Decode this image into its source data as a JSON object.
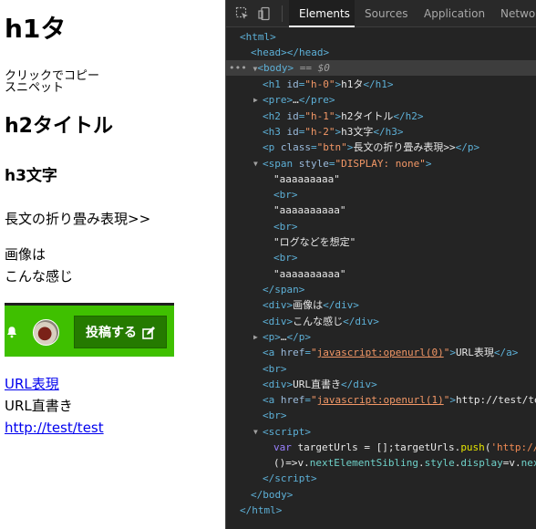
{
  "page": {
    "h1": "h1タ",
    "pre_lines": [
      "クリックでコピー",
      "スニペット"
    ],
    "h2": "h2タイトル",
    "h3": "h3文字",
    "toggle_text": "長文の折り畳み表現>>",
    "image_lines": [
      "画像は",
      "こんな感じ"
    ],
    "post_button_label": "投稿する",
    "link_url_label": "URL表現",
    "url_plain": "URL直書き",
    "url_link": "http://test/test",
    "colors": {
      "post_bar": "#3fc000",
      "post_button": "#257a00",
      "link": "#0000ee"
    }
  },
  "devtools": {
    "toolbar_icons": [
      "inspect-icon",
      "device-toolbar-icon"
    ],
    "tabs": [
      "Elements",
      "Sources",
      "Application",
      "Network"
    ],
    "active_tab": "Elements",
    "tree": {
      "html_open": "html",
      "head": "head",
      "body": "body",
      "selected_marker": "== $0",
      "h1": {
        "id": "h-0",
        "text": "h1タ"
      },
      "pre_ellipsis": "…",
      "h2": {
        "id": "h-1",
        "text": "h2タイトル"
      },
      "h3": {
        "id": "h-2",
        "text": "h3文字"
      },
      "p_btn": {
        "class": "btn",
        "text": "長文の折り畳み表現>>"
      },
      "span_style": "DISPLAY: none",
      "span_texts": [
        "\"aaaaaaaaa\"",
        "\"aaaaaaaaaa\"",
        "\"ログなどを想定\"",
        "\"aaaaaaaaaa\""
      ],
      "div_image": "画像は",
      "div_kanji": "こんな感じ",
      "a0": {
        "href": "javascript:openurl(0)",
        "text": "URL表現"
      },
      "div_url": "URL直書き",
      "a1": {
        "href": "javascript:openurl(1)",
        "text": "http://test/te"
      },
      "script_line1": {
        "kw": "var",
        "decl": " targetUrls = [];targetUrls.",
        "fn": "push",
        "rest": "(",
        "str": "'http://"
      },
      "script_line2": {
        "a": "()=>v.",
        "b": "nextElementSibling",
        "c": ".",
        "d": "style",
        "e": ".",
        "f": "display",
        "g": "=v.",
        "h": "nex"
      },
      "dots": "•••"
    }
  }
}
